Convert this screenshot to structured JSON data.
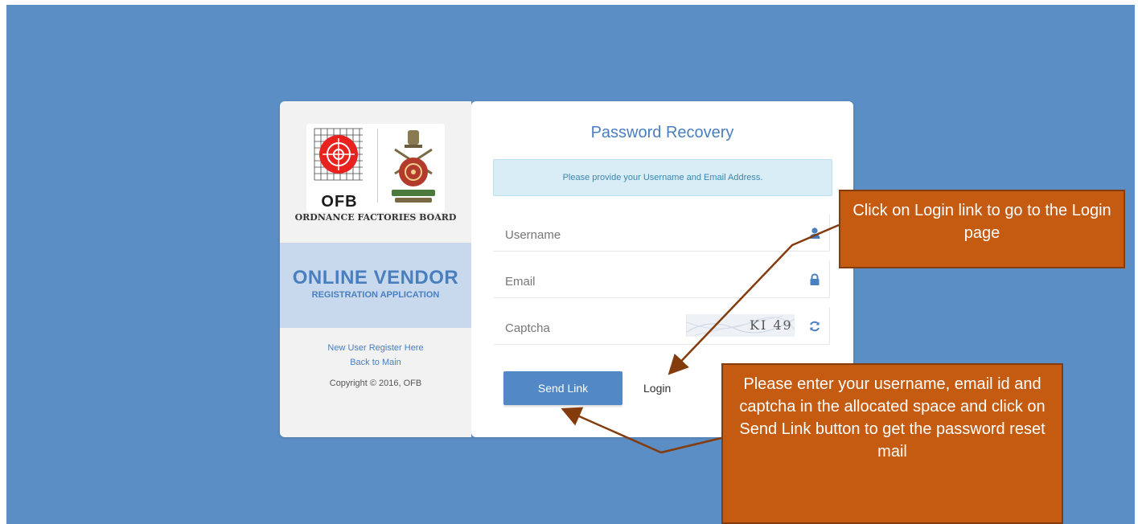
{
  "sidebar": {
    "logo_text": "OFB",
    "org_name": "ORDNANCE FACTORIES BOARD",
    "app_title": "ONLINE VENDOR",
    "app_subtitle": "REGISTRATION APPLICATION",
    "register_link": "New User Register Here",
    "back_link": "Back to Main",
    "copyright": "Copyright © 2016, OFB"
  },
  "form": {
    "title": "Password Recovery",
    "info_message": "Please provide your Username and Email Address.",
    "username_placeholder": "Username",
    "email_placeholder": "Email",
    "captcha_placeholder": "Captcha",
    "captcha_text": "KI 49",
    "send_button": "Send Link",
    "login_link": "Login"
  },
  "annotations": {
    "login_hint": "Click on Login link to go to the Login page",
    "send_hint": "Please enter your username, email id and captcha in the allocated space and click on Send Link button to get the password reset mail"
  },
  "colors": {
    "background": "#5b8ec5",
    "accent": "#4a7fbf",
    "button": "#5288c5",
    "callout": "#c55a11",
    "arrow": "#843c0c"
  },
  "icons": {
    "username": "user-icon",
    "email": "lock-icon",
    "captcha": "refresh-icon"
  }
}
